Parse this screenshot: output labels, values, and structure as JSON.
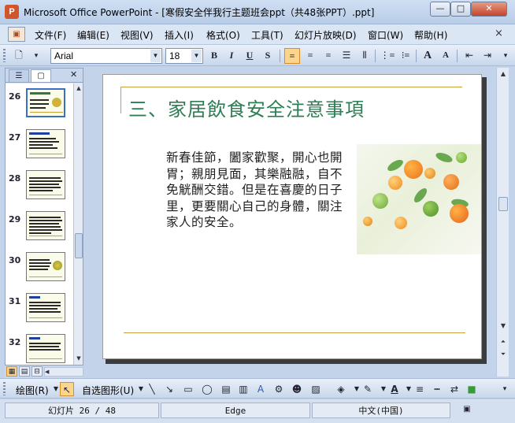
{
  "window": {
    "title": "Microsoft Office PowerPoint - [寒假安全伴我行主题班会ppt（共48张PPT）.ppt]",
    "app_icon": "P",
    "minimize": "—",
    "maximize": "□",
    "close": "✕"
  },
  "menu": {
    "items": [
      "文件(F)",
      "编辑(E)",
      "视图(V)",
      "插入(I)",
      "格式(O)",
      "工具(T)",
      "幻灯片放映(D)",
      "窗口(W)",
      "帮助(H)"
    ],
    "close_icon": "×"
  },
  "format_toolbar": {
    "font": "Arial",
    "size": "18",
    "bold": "B",
    "italic": "I",
    "underline": "U",
    "shadow": "S",
    "grow": "A",
    "shrink": "A"
  },
  "left_pane": {
    "tabs": [
      "outline-tab",
      "slides-tab"
    ],
    "thumbnails": [
      {
        "num": "26",
        "selected": true
      },
      {
        "num": "27",
        "selected": false
      },
      {
        "num": "28",
        "selected": false
      },
      {
        "num": "29",
        "selected": false
      },
      {
        "num": "30",
        "selected": false
      },
      {
        "num": "31",
        "selected": false
      },
      {
        "num": "32",
        "selected": false
      }
    ]
  },
  "slide": {
    "title": "三、家居飲食安全注意事項",
    "body": "新春佳節，闔家歡聚，開心也開胃；親朋見面，其樂融融，自不免觥酬交錯。但是在喜慶的日子里，更要關心自己的身體，關注家人的安全。"
  },
  "draw_toolbar": {
    "draw": "绘图(R)",
    "autoshapes": "自选图形(U)"
  },
  "status": {
    "slide_pos": "幻灯片 26 / 48",
    "design": "Edge",
    "language": "中文(中国)"
  },
  "colors": {
    "title_green": "#2e7d54",
    "gold_rule": "#c8a23a",
    "active_btn": "#fbd58c"
  }
}
